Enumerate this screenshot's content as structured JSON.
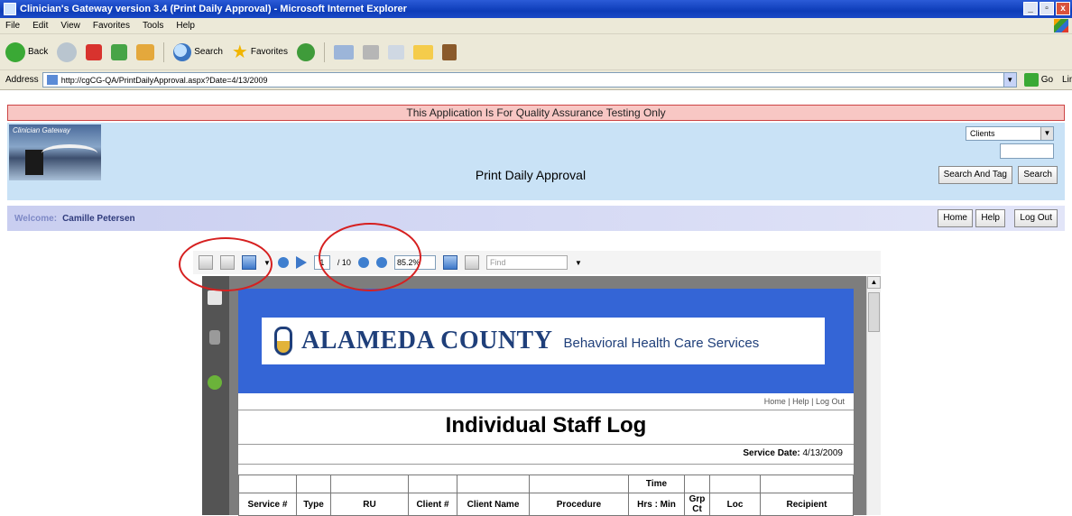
{
  "browser": {
    "title": "Clinician's Gateway version 3.4 (Print Daily Approval) - Microsoft Internet Explorer",
    "window_buttons": [
      "_",
      "▫",
      "x"
    ],
    "menu": [
      "File",
      "Edit",
      "View",
      "Favorites",
      "Tools",
      "Help"
    ],
    "toolbar": {
      "back": "Back",
      "search": "Search",
      "favorites": "Favorites"
    },
    "address_label": "Address",
    "address_url": "http://cgCG-QA/PrintDailyApproval.aspx?Date=4/13/2009",
    "go_label": "Go",
    "links_label": "Links"
  },
  "app": {
    "qa_banner": "This Application Is For Quality Assurance Testing Only",
    "logo_text": "Clinician Gateway",
    "page_title": "Print Daily Approval",
    "search_select": "Clients",
    "search_and_tag_button": "Search And Tag",
    "search_button": "Search",
    "welcome_label": "Welcome:",
    "user_name": "Camille Petersen",
    "nav": {
      "home": "Home",
      "help": "Help",
      "logout": "Log Out"
    }
  },
  "pdf_viewer": {
    "current_page": "1",
    "total_pages": "/ 10",
    "zoom": "85.2%",
    "find_placeholder": "Find"
  },
  "report": {
    "county_name": "ALAMEDA COUNTY",
    "county_sub": "Behavioral Health Care Services",
    "page_links": "Home | Help | Log Out",
    "title": "Individual Staff Log",
    "service_date_label": "Service Date:",
    "service_date": "4/13/2009",
    "columns": [
      "Service #",
      "Type",
      "RU",
      "Client #",
      "Client Name",
      "Procedure",
      "Hrs : Min",
      "Grp Ct",
      "Loc",
      "Recipient"
    ],
    "time_header": "Time"
  }
}
